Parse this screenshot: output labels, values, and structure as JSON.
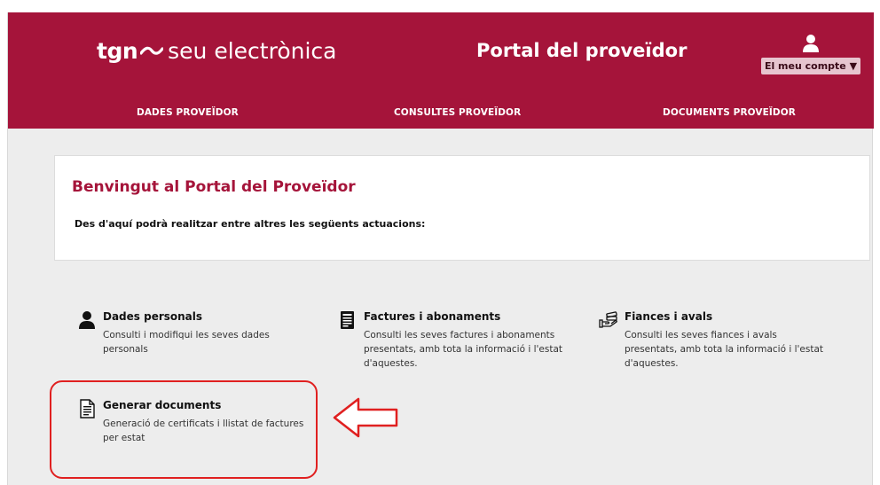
{
  "header": {
    "logo_brand": "tgn",
    "logo_text": "seu electrònica",
    "portal_title": "Portal del proveïdor",
    "account_label": "El meu compte ▼",
    "bg_color": "#a5143a"
  },
  "nav": {
    "items": [
      {
        "label": "DADES PROVEÏDOR"
      },
      {
        "label": "CONSULTES PROVEÏDOR"
      },
      {
        "label": "DOCUMENTS PROVEÏDOR"
      }
    ]
  },
  "welcome": {
    "title": "Benvingut al Portal del Proveïdor",
    "subtitle": "Des d'aquí podrà realitzar entre altres les següents actuacions:"
  },
  "cards": [
    {
      "icon": "person-icon",
      "title": "Dades personals",
      "desc": "Consulti i modifiqui les seves dades personals"
    },
    {
      "icon": "invoice-icon",
      "title": "Factures i abonaments",
      "desc": "Consulti les seves factures i abonaments presentats, amb tota la informació i l'estat d'aquestes."
    },
    {
      "icon": "hand-money-icon",
      "title": "Fiances i avals",
      "desc": "Consulti les seves fiances i avals presentats, amb tota la informació i l'estat d'aquestes."
    },
    {
      "icon": "document-icon",
      "title": "Generar documents",
      "desc": "Generació de certificats i llistat de factures per estat"
    }
  ],
  "annotation": {
    "highlight_color": "#e02020",
    "arrow_icon": "left-arrow-icon"
  }
}
